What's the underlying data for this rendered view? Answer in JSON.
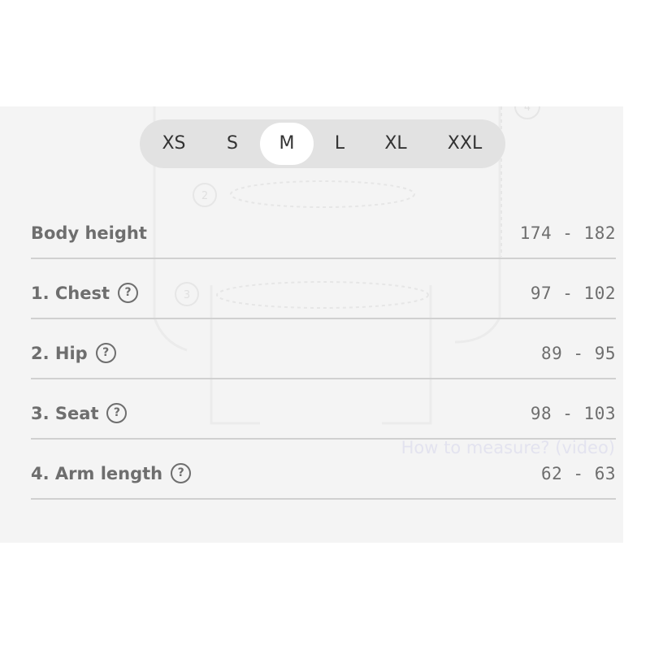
{
  "size_selector": {
    "options": [
      "XS",
      "S",
      "M",
      "L",
      "XL",
      "XXL"
    ],
    "selected": "M"
  },
  "illustration_markers": [
    "2",
    "3",
    "4"
  ],
  "measure_link": "How to measure? (video)",
  "measurements": [
    {
      "label": "Body height",
      "value": "174 - 182",
      "has_help": false
    },
    {
      "label": "1. Chest",
      "value": "97 - 102",
      "has_help": true
    },
    {
      "label": "2. Hip",
      "value": "89 - 95",
      "has_help": true
    },
    {
      "label": "3. Seat",
      "value": "98 - 103",
      "has_help": true
    },
    {
      "label": "4. Arm length",
      "value": "62 - 63",
      "has_help": true
    }
  ],
  "help_icon_glyph": "?",
  "colors": {
    "panel_bg": "#f4f4f4",
    "selector_bg": "#e2e2e2",
    "selected_bg": "#ffffff",
    "text": "#6e6e6e",
    "divider": "#d0d0d0"
  }
}
